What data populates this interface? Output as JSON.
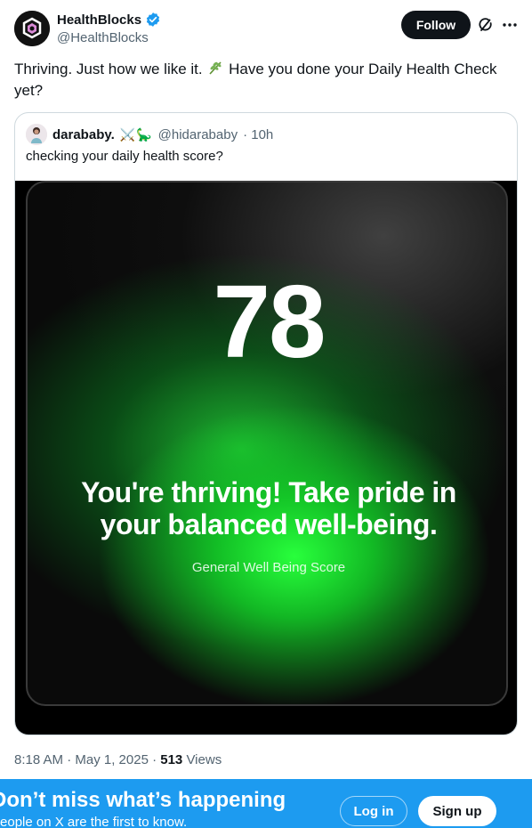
{
  "author": {
    "display_name": "HealthBlocks",
    "handle": "@HealthBlocks",
    "avatar_icon": "healthblocks-logo-icon",
    "verified_icon": "verified-badge-icon",
    "verified_color": "#1d9bf0"
  },
  "actions": {
    "follow_label": "Follow",
    "grok_icon": "grok-icon",
    "more_icon": "more-icon"
  },
  "tweet": {
    "text_before": "Thriving. Just how we like it.",
    "text_after": "Have you done your Daily Health Check yet?",
    "emoji_icon": "herb-icon"
  },
  "quote": {
    "display_name": "darababy.",
    "emoji": "⚔️🦕",
    "handle": "@hidarababy",
    "time": "· 10h",
    "text": "checking your daily health score?"
  },
  "media": {
    "score": "78",
    "headline": "You're thriving! Take pride in your balanced well-being.",
    "subtitle": "General Well Being Score",
    "accent_color": "#22ff3c"
  },
  "meta": {
    "timestamp": "8:18 AM · May 1, 2025 ·",
    "views_count": "513",
    "views_label": "Views"
  },
  "banner": {
    "title": "Don’t miss what’s happening",
    "subtitle": "People on X are the first to know.",
    "login_label": "Log in",
    "signup_label": "Sign up",
    "background": "#1d9bf0"
  }
}
